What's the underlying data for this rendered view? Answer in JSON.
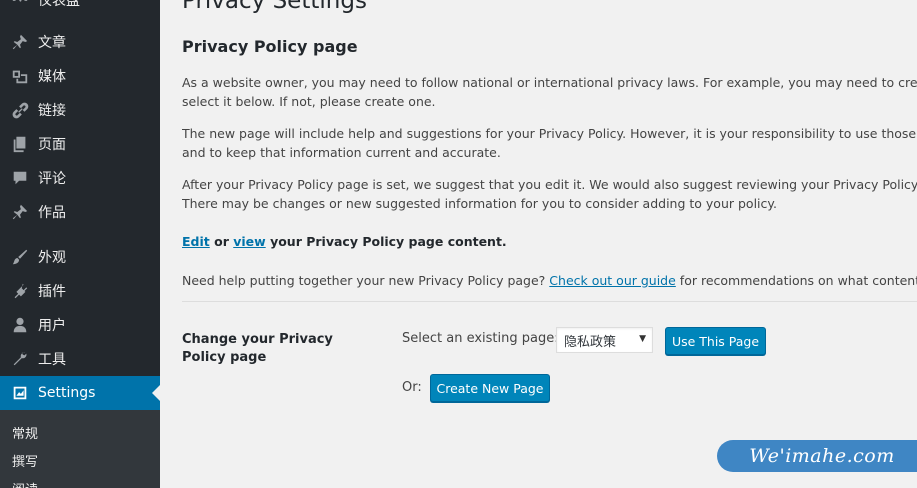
{
  "sidebar": {
    "top_partial": "仪表盘",
    "items": [
      {
        "label": "文章",
        "icon": "pin-icon"
      },
      {
        "label": "媒体",
        "icon": "media-icon"
      },
      {
        "label": "链接",
        "icon": "link-icon"
      },
      {
        "label": "页面",
        "icon": "page-icon"
      },
      {
        "label": "评论",
        "icon": "comment-icon"
      },
      {
        "label": "作品",
        "icon": "pin-icon"
      },
      {
        "label": "外观",
        "icon": "brush-icon"
      },
      {
        "label": "插件",
        "icon": "plugin-icon"
      },
      {
        "label": "用户",
        "icon": "user-icon"
      },
      {
        "label": "工具",
        "icon": "wrench-icon"
      },
      {
        "label": "Settings",
        "icon": "settings-icon",
        "current": true
      }
    ],
    "submenu": [
      "常规",
      "撰写",
      "阅读"
    ]
  },
  "main": {
    "page_title": "Privacy Settings",
    "section_title": "Privacy Policy page",
    "para1": [
      "As a website owner, you may need to follow national or international privacy laws. For example, you may need to create and disp",
      "select it below. If not, please create one."
    ],
    "para2": [
      "The new page will include help and suggestions for your Privacy Policy. However, it is your responsibility to use those resources c",
      "and to keep that information current and accurate."
    ],
    "para3": [
      "After your Privacy Policy page is set, we suggest that you edit it. We would also suggest reviewing your Privacy Policy from time t",
      "There may be changes or new suggested information for you to consider adding to your policy."
    ],
    "edit_link": "Edit",
    "or_word": "or",
    "view_link": "view",
    "edit_line_rest": "your Privacy Policy page content.",
    "help_text": "Need help putting together your new Privacy Policy page?",
    "guide_link": "Check out our guide",
    "help_rest": "for recommendations on what content to include",
    "form_label": "Change your Privacy Policy page",
    "select_label": "Select an existing page:",
    "select_value": "隐私政策",
    "use_button": "Use This Page",
    "or_label": "Or:",
    "create_button": "Create New Page"
  },
  "watermark": "We'imahe.com",
  "colors": {
    "sidebar_bg": "#23282d",
    "submenu_bg": "#32373c",
    "accent": "#0073aa",
    "button": "#0085ba",
    "content_bg": "#f1f1f1"
  }
}
